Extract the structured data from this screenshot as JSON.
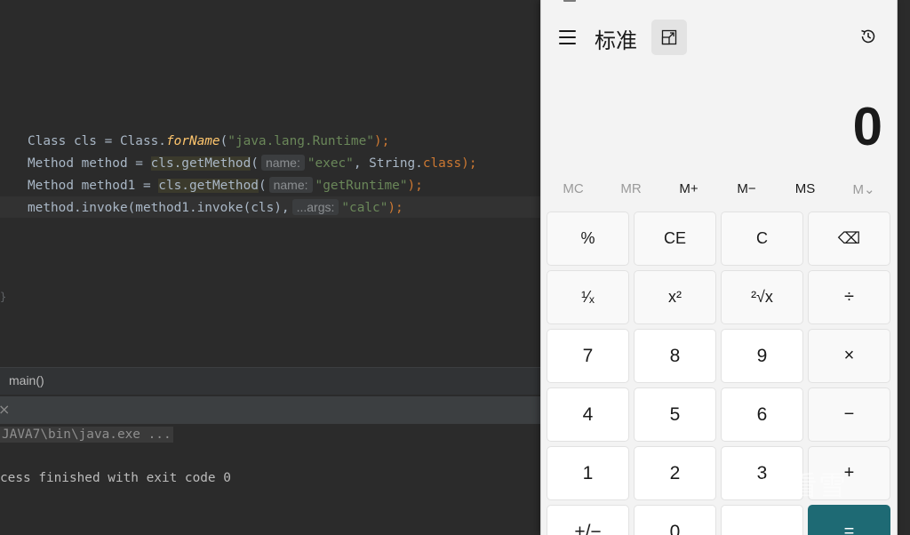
{
  "editor": {
    "lines": [
      {
        "parts": [
          [
            "Class cls = Class.",
            "t"
          ],
          [
            "forName",
            "ital"
          ],
          [
            "(",
            "t"
          ],
          [
            "\"java.lang.Runtime\"",
            "str"
          ],
          [
            ");",
            "kw"
          ]
        ]
      },
      {
        "parts": [
          [
            "Method method = ",
            "t"
          ],
          [
            "cls.getMethod",
            "hl"
          ],
          [
            "(",
            "t"
          ],
          [
            "name:",
            "hint"
          ],
          [
            "\"exec\"",
            "str"
          ],
          [
            ", String.",
            "t"
          ],
          [
            "class",
            "kw"
          ],
          [
            ");",
            "kw"
          ]
        ]
      },
      {
        "parts": [
          [
            "Method method1 = ",
            "t"
          ],
          [
            "cls.getMethod",
            "hl"
          ],
          [
            "(",
            "t"
          ],
          [
            "name:",
            "hint"
          ],
          [
            "\"getRuntime\"",
            "str"
          ],
          [
            ");",
            "kw"
          ]
        ]
      },
      {
        "parts": [
          [
            "method.invoke(method1.invoke(cls),",
            "t"
          ],
          [
            "...args:",
            "hint"
          ],
          [
            "\"calc\"",
            "str"
          ],
          [
            ");",
            "kw"
          ]
        ]
      }
    ],
    "breadcrumb": "main()",
    "run_command": "JAVA7\\bin\\java.exe ...",
    "exit_message": "cess finished with exit code 0"
  },
  "calculator": {
    "mode": "标准",
    "display_value": "0",
    "memory_buttons": [
      "MC",
      "MR",
      "M+",
      "M−",
      "MS",
      "M⌄"
    ],
    "memory_enabled": [
      false,
      false,
      true,
      true,
      true,
      false
    ],
    "keys": [
      [
        "%",
        "CE",
        "C",
        "⌫"
      ],
      [
        "¹⁄ₓ",
        "x²",
        "²√x",
        "÷"
      ],
      [
        "7",
        "8",
        "9",
        "×"
      ],
      [
        "4",
        "5",
        "6",
        "−"
      ],
      [
        "1",
        "2",
        "3",
        "+"
      ],
      [
        "+/−",
        "0",
        ".",
        "="
      ]
    ],
    "accent_color": "#1e6a74"
  },
  "watermark": "看雪"
}
